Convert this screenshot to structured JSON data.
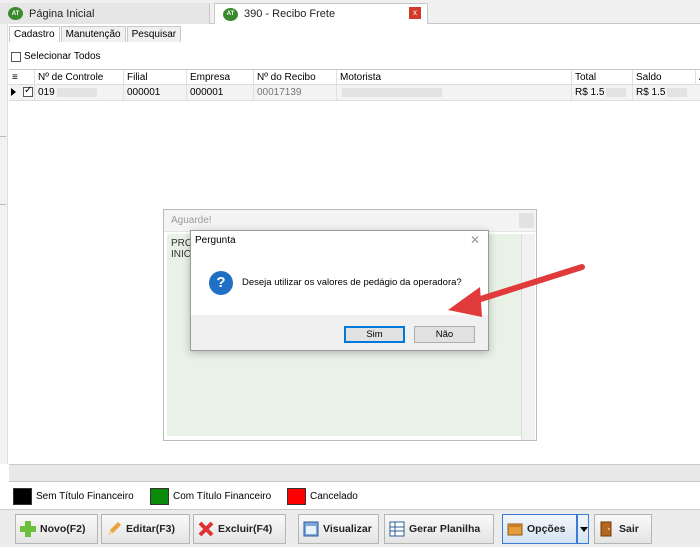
{
  "tabs": [
    {
      "label": "Página Inicial",
      "icon": "app-logo-icon"
    },
    {
      "label": "390 - Recibo Frete",
      "icon": "app-logo-icon",
      "close": "x"
    }
  ],
  "app_icon_text": "AT",
  "subtabs": [
    "Cadastro",
    "Manutenção",
    "Pesquisar"
  ],
  "select_all_label": "Selecionar Todos",
  "grid": {
    "columns": [
      "Nº de Controle",
      "Filial",
      "Empresa",
      "Nº do Recibo",
      "Motorista",
      "Total",
      "Saldo"
    ],
    "row": {
      "controle": "019",
      "filial": "000001",
      "empresa": "000001",
      "recibo": "00017139",
      "motorista": "",
      "total": "R$ 1.5",
      "saldo": "R$ 1.5"
    }
  },
  "wait_dialog": {
    "title": "Aguarde!",
    "line1": "PRO",
    "line2": "INIC"
  },
  "question_dialog": {
    "title": "Pergunta",
    "icon_glyph": "?",
    "message": "Deseja utilizar os valores de pedágio da operadora?",
    "yes_label": "Sim",
    "no_label": "Não",
    "close_glyph": "✕"
  },
  "arrow_color": "#e03a3a",
  "legend": [
    {
      "label": "Sem Título Financeiro",
      "color": "#000000"
    },
    {
      "label": "Com Título Financeiro",
      "color": "#0a8a0a"
    },
    {
      "label": "Cancelado",
      "color": "#ff0000"
    }
  ],
  "toolbar": {
    "novo": "Novo(F2)",
    "editar": "Editar(F3)",
    "excluir": "Excluir(F4)",
    "visualizar": "Visualizar",
    "gerar_planilha": "Gerar Planilha",
    "opcoes": "Opções",
    "sair": "Sair"
  }
}
